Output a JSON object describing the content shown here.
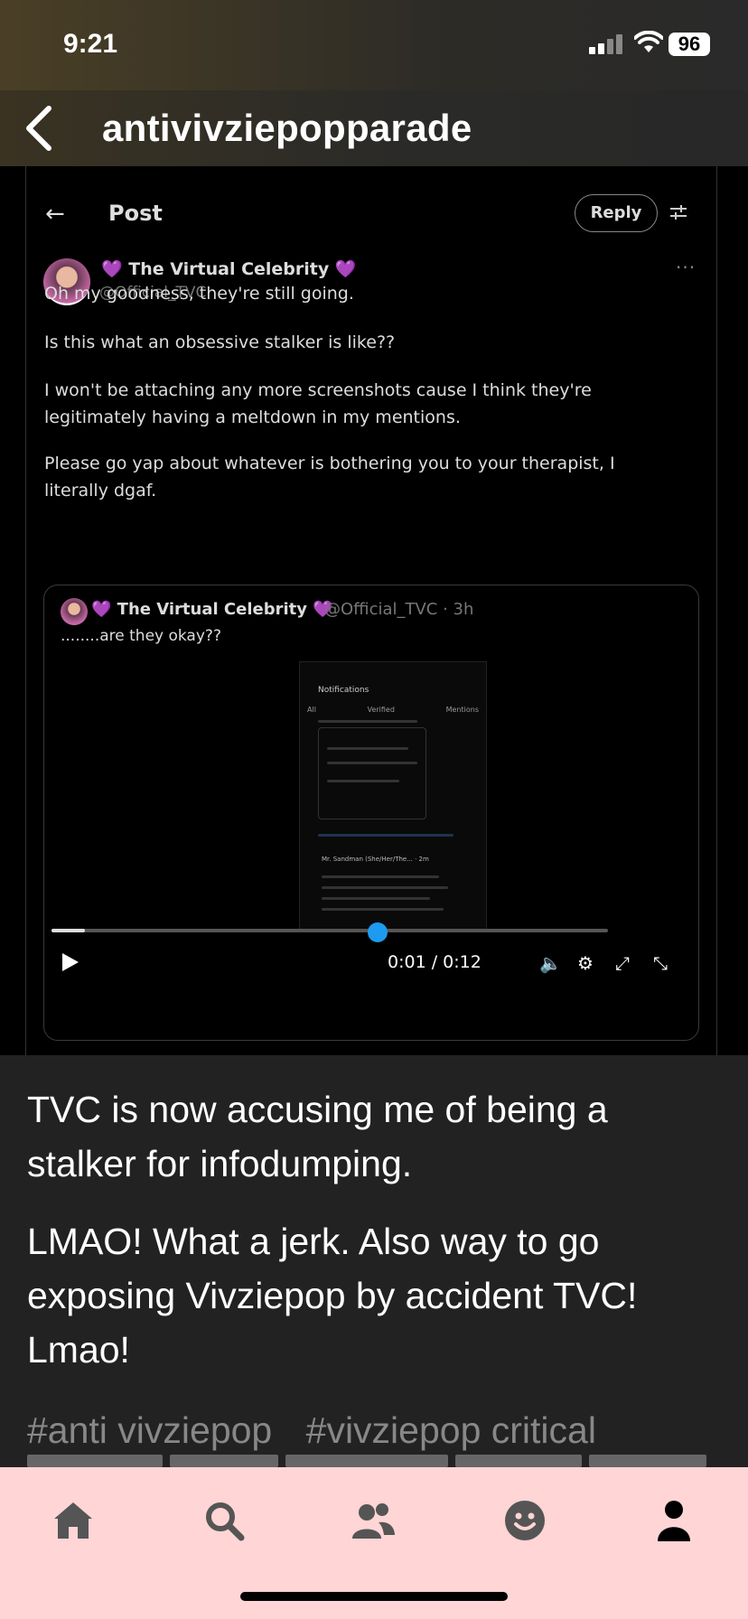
{
  "status_bar": {
    "time": "9:21",
    "battery": "96"
  },
  "header": {
    "blog_name": "antivivziepopparade",
    "back_icon": "chevron-left-icon"
  },
  "screenshot": {
    "title": "Post",
    "reply_label": "Reply",
    "user": {
      "display_name": "💜 The Virtual Celebrity 💜",
      "handle": "@Official_TVC"
    },
    "post_lines": [
      "Oh my goodness, they're still going.",
      "Is this what an obsessive stalker is like??",
      "I won't be attaching any more screenshots cause I think they're legitimately having a meltdown in my mentions.",
      "Please go yap about whatever is bothering you to your therapist, I literally dgaf."
    ],
    "quote": {
      "display_name": "💜 The Virtual Celebrity 💜",
      "handle_time": "@Official_TVC · 3h",
      "text": "........are they okay??",
      "video": {
        "header": "Notifications",
        "tabs": [
          "All",
          "Verified",
          "Mentions"
        ],
        "reply_name": "Mr. Sandman (She/Her/The... · 2m",
        "time": "0:01 / 0:12",
        "progress": 0.06
      }
    }
  },
  "body": {
    "paragraph_1": "TVC is now accusing me of being a stalker for infodumping.",
    "paragraph_2": "LMAO! What a jerk. Also way to go exposing Vivziepop by accident TVC! Lmao!"
  },
  "tags": [
    "#anti vivziepop",
    "#vivziepop critical"
  ],
  "bottom_nav": {
    "items": [
      "home-icon",
      "search-icon",
      "people-icon",
      "smiley-icon",
      "account-icon"
    ],
    "background": "#ffd5d5"
  }
}
